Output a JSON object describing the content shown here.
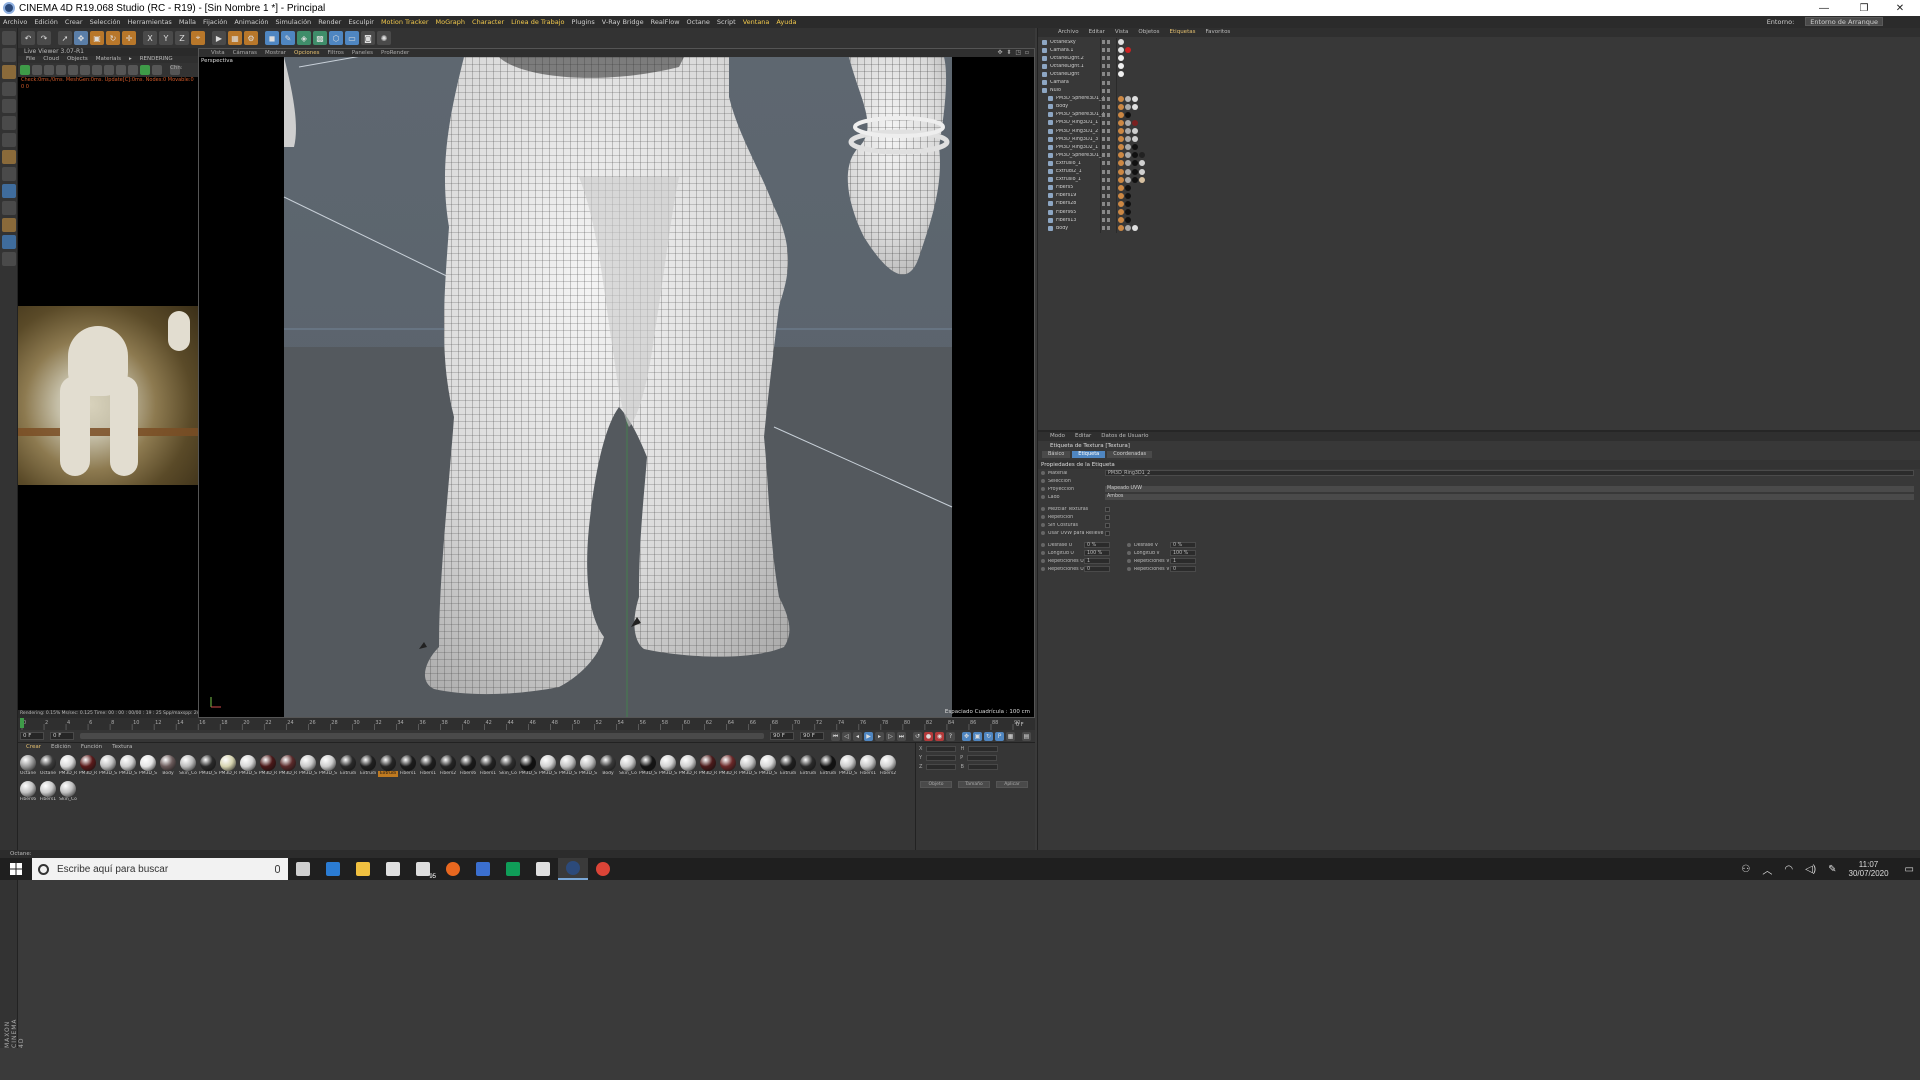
{
  "window": {
    "title": "CINEMA 4D R19.068 Studio (RC - R19) - [Sin Nombre 1 *] - Principal",
    "controls": [
      "—",
      "❐",
      "✕"
    ]
  },
  "menu": {
    "items": [
      "Archivo",
      "Edición",
      "Crear",
      "Selección",
      "Herramientas",
      "Malla",
      "Fijación",
      "Animación",
      "Simulación",
      "Render",
      "Esculpir",
      "Motion Tracker",
      "MoGraph",
      "Character",
      "Línea de Trabajo",
      "Plugins",
      "V-Ray Bridge",
      "RealFlow",
      "Octane",
      "Script",
      "Ventana",
      "Ayuda"
    ],
    "highlighted": [
      "Motion Tracker",
      "MoGraph",
      "Character",
      "Línea de Trabajo",
      "Ventana",
      "Ayuda"
    ],
    "layout_label": "Entorno:",
    "layout_value": "Entorno de Arranque"
  },
  "toolbar": {
    "axis_x": "X",
    "axis_y": "Y",
    "axis_z": "Z"
  },
  "live_viewer": {
    "title": "Live Viewer 3.07-R1",
    "menu": [
      "File",
      "Cloud",
      "Objects",
      "Materials",
      "▸",
      "RENDERING"
    ],
    "channel_label": "Chn:",
    "status": "Check:0ms./0ms. MeshGen:0ms. Update[C]:0ms. Nodes:0 Movable:0  0  0",
    "footer": "Rendering: 0.15%   Ms/sec: 0.125   Time: 00 : 00 : 00/00 : 19 : 25   Spp/maxspp: 24/1000   Tri: 0/0"
  },
  "viewport": {
    "menu": [
      "Vista",
      "Cámaras",
      "Mostrar",
      "Opciones",
      "Filtros",
      "Paneles",
      "ProRender"
    ],
    "active_menu": "Opciones",
    "label": "Perspectiva",
    "grid_text": "Espaciado Cuadrícula : 100 cm",
    "controls": "✥ ⬍ ◳ ▫"
  },
  "timeline": {
    "ticks": [
      "0",
      "2",
      "4",
      "6",
      "8",
      "10",
      "12",
      "14",
      "16",
      "18",
      "20",
      "22",
      "24",
      "26",
      "28",
      "30",
      "32",
      "34",
      "36",
      "38",
      "40",
      "42",
      "44",
      "46",
      "48",
      "50",
      "52",
      "54",
      "56",
      "58",
      "60",
      "62",
      "64",
      "66",
      "68",
      "70",
      "72",
      "74",
      "76",
      "78",
      "80",
      "82",
      "84",
      "86",
      "88",
      "90"
    ],
    "end_frame": "0 F",
    "start_field": "0 F",
    "current_field": "0 F",
    "max_field": "90 F",
    "end_field": "90 F"
  },
  "materials": {
    "tabs": [
      "Crear",
      "Edición",
      "Función",
      "Textura"
    ],
    "active_tab": "Crear",
    "items": [
      {
        "name": "Octane",
        "color": "#9a9a9a"
      },
      {
        "name": "Octane",
        "color": "#3c3c3c"
      },
      {
        "name": "PM3D_R",
        "color": "#d8d8d8"
      },
      {
        "name": "PM3D_R",
        "color": "#5a1a1a"
      },
      {
        "name": "PM3D_S",
        "color": "#c0c0c0"
      },
      {
        "name": "PM3D_S",
        "color": "#cfcfcf"
      },
      {
        "name": "PM3D_S",
        "color": "#e4e4e4"
      },
      {
        "name": "Body",
        "color": "#6a5a5a"
      },
      {
        "name": "Skin_Co",
        "color": "#bbbbbb"
      },
      {
        "name": "PM3D_S",
        "color": "#2a2a2a"
      },
      {
        "name": "PM3D_R",
        "color": "#d6d4b0"
      },
      {
        "name": "PM3D_S",
        "color": "#d5d5d5"
      },
      {
        "name": "PM3D_R",
        "color": "#4a1818"
      },
      {
        "name": "PM3D_R",
        "color": "#5a2a2a"
      },
      {
        "name": "PM3D_S",
        "color": "#c8c8c8"
      },
      {
        "name": "PM3D_S",
        "color": "#cdcdcd"
      },
      {
        "name": "Extrudi",
        "color": "#2a2a2a"
      },
      {
        "name": "Extrudi",
        "color": "#202020"
      },
      {
        "name": "Extrudi",
        "color": "#262626"
      },
      {
        "name": "Fibers1",
        "color": "#1c1c1c"
      },
      {
        "name": "Fibers1",
        "color": "#1e1e1e"
      },
      {
        "name": "Fibers2",
        "color": "#252525"
      },
      {
        "name": "Fibers6",
        "color": "#1a1a1a"
      },
      {
        "name": "Fibers1",
        "color": "#232323"
      },
      {
        "name": "Skin_Co",
        "color": "#2e2e2e"
      },
      {
        "name": "PM3D_S",
        "color": "#101010"
      },
      {
        "name": "PM3D_S",
        "color": "#d0d0d0"
      },
      {
        "name": "PM3D_S",
        "color": "#c2c2c2"
      },
      {
        "name": "PM3D_S",
        "color": "#bdbdbd"
      },
      {
        "name": "Body",
        "color": "#3a3a3a"
      },
      {
        "name": "Skin_Co",
        "color": "#cacaca"
      },
      {
        "name": "PM3D_S",
        "color": "#151515"
      },
      {
        "name": "PM3D_S",
        "color": "#d2d2d2"
      },
      {
        "name": "PM3D_R",
        "color": "#cecece"
      },
      {
        "name": "PM3D_R",
        "color": "#4b1a1a"
      },
      {
        "name": "PM3D_R",
        "color": "#6a2828"
      },
      {
        "name": "PM3D_S",
        "color": "#c4c4c4"
      },
      {
        "name": "PM3D_S",
        "color": "#d7d7d7"
      },
      {
        "name": "Extrudi",
        "color": "#1f1f1f"
      },
      {
        "name": "Extrudi",
        "color": "#2b2b2b"
      },
      {
        "name": "Extrudi",
        "color": "#121212"
      },
      {
        "name": "PM3D_S",
        "color": "#cbcbcb"
      },
      {
        "name": "Fibers1",
        "color": "#c6c6c6"
      },
      {
        "name": "Fibers2",
        "color": "#d0d0d0"
      },
      {
        "name": "Fibers6",
        "color": "#c0c0c0"
      },
      {
        "name": "Fibers1",
        "color": "#c9c9c9"
      },
      {
        "name": "Skin_Co",
        "color": "#bfbfbf"
      }
    ],
    "active_name": "Extrudi"
  },
  "coords": {
    "labels": [
      "X",
      "Y",
      "Z",
      "H",
      "P",
      "B"
    ],
    "buttons": [
      "Objeto",
      "Tamaño",
      "Aplicar"
    ]
  },
  "status_bar": {
    "text": "Octane:"
  },
  "object_manager": {
    "tabs": [
      "Archivo",
      "Editar",
      "Vista",
      "Objetos",
      "Etiquetas",
      "Favoritos"
    ],
    "active_tab": "Etiquetas",
    "objects": [
      {
        "name": "OctaneSky",
        "tags": [
          "#e0e0e0"
        ]
      },
      {
        "name": "Cámara.1",
        "tags": [
          "#e0e0e0",
          "#cc2222"
        ]
      },
      {
        "name": "OctaneLight.2",
        "tags": [
          "#f0f0f0"
        ]
      },
      {
        "name": "OctaneLight.1",
        "tags": [
          "#f0f0f0"
        ]
      },
      {
        "name": "OctaneLight",
        "tags": [
          "#f0f0f0"
        ]
      },
      {
        "name": "Cámara",
        "tags": []
      },
      {
        "name": "Nulo",
        "tags": []
      },
      {
        "name": "PM3D_Sphere3D1_2",
        "tags": [
          "#cc8844",
          "#b8b8b8",
          "#e0e0e0"
        ]
      },
      {
        "name": "Body",
        "tags": [
          "#cc8844",
          "#aaaaaa",
          "#e0e0e0"
        ]
      },
      {
        "name": "PM3D_Sphere3D1_2",
        "tags": [
          "#cc8844",
          "#111111"
        ]
      },
      {
        "name": "PM3D_Ring3D1_1",
        "tags": [
          "#cc8844",
          "#aaaaaa",
          "#7a2020"
        ]
      },
      {
        "name": "PM3D_Ring3D1_2",
        "tags": [
          "#cc8844",
          "#aaaaaa",
          "#cfcfcf"
        ]
      },
      {
        "name": "PM3D_Ring3D1_3",
        "tags": [
          "#cc8844",
          "#aaaaaa",
          "#cfcfcf"
        ]
      },
      {
        "name": "PM3D_Ring3D2_1",
        "tags": [
          "#cc8844",
          "#aaaaaa",
          "#111111"
        ]
      },
      {
        "name": "PM3D_Sphere3D1_1",
        "tags": [
          "#cc8844",
          "#aaaaaa",
          "#111111",
          "#222222"
        ]
      },
      {
        "name": "Extrusió_1",
        "tags": [
          "#cc8844",
          "#aaaaaa",
          "#111111",
          "#d0d0d0"
        ]
      },
      {
        "name": "Extrudi2_1",
        "tags": [
          "#cc8844",
          "#aaaaaa",
          "#111111",
          "#d0d0d0"
        ]
      },
      {
        "name": "Extrusió_1",
        "tags": [
          "#cc8844",
          "#aaaaaa",
          "#111111",
          "#d6c0a0"
        ]
      },
      {
        "name": "Fibers5",
        "tags": [
          "#cc8844",
          "#111111"
        ]
      },
      {
        "name": "Fibers19",
        "tags": [
          "#cc8844",
          "#111111"
        ]
      },
      {
        "name": "Fibers28",
        "tags": [
          "#cc8844",
          "#111111"
        ]
      },
      {
        "name": "Fibers65",
        "tags": [
          "#cc8844",
          "#111111"
        ]
      },
      {
        "name": "Fibers13",
        "tags": [
          "#cc8844",
          "#111111"
        ]
      },
      {
        "name": "Body",
        "tags": [
          "#cc8844",
          "#aaaaaa",
          "#e0e0e0"
        ]
      }
    ]
  },
  "attributes": {
    "tabs": [
      "Modo",
      "Editar",
      "Datos de Usuario"
    ],
    "title": "Etiqueta de Textura [Textura]",
    "subtabs": [
      "Básico",
      "Etiqueta",
      "Coordenadas"
    ],
    "active_subtab": "Etiqueta",
    "section": "Propiedades de la Etiqueta",
    "material_label": "Material",
    "material_value": "PM3D_Ring3D1_2",
    "selection_label": "Selección",
    "projection_label": "Proyección",
    "projection_value": "Mapeado UVW",
    "side_label": "Lado",
    "side_value": "Ambos",
    "checks": [
      "Mezclar Texturas",
      "Repetición",
      "Sin Costuras",
      "Usar UVW para Relieve"
    ],
    "pairs": [
      {
        "l1": "Desfase U",
        "v1": "0 %",
        "l2": "Desfase V",
        "v2": "0 %"
      },
      {
        "l1": "Longitud U",
        "v1": "100 %",
        "l2": "Longitud V",
        "v2": "100 %"
      },
      {
        "l1": "Repeticiones U",
        "v1": "1",
        "l2": "Repeticiones V",
        "v2": "1"
      },
      {
        "l1": "Repeticiones U",
        "v1": "0",
        "l2": "Repeticiones V",
        "v2": "0"
      }
    ]
  },
  "taskbar": {
    "search_placeholder": "Escribe aquí para buscar",
    "mail_badge": "95",
    "apps": [
      {
        "name": "task-view",
        "color": "#cfcfcf"
      },
      {
        "name": "edge",
        "color": "#2b7cd3"
      },
      {
        "name": "explorer",
        "color": "#f0c040"
      },
      {
        "name": "store",
        "color": "#e0e0e0"
      },
      {
        "name": "mail",
        "color": "#dddddd"
      },
      {
        "name": "firefox",
        "color": "#e8671f"
      },
      {
        "name": "word-online",
        "color": "#3b6fcf"
      },
      {
        "name": "k-app",
        "color": "#0f9d58"
      },
      {
        "name": "photos",
        "color": "#e0e0e0"
      },
      {
        "name": "cinema4d",
        "color": "#2c4a7a"
      },
      {
        "name": "chrome",
        "color": "#db4437"
      }
    ],
    "time": "11:07",
    "date": "30/07/2020"
  }
}
